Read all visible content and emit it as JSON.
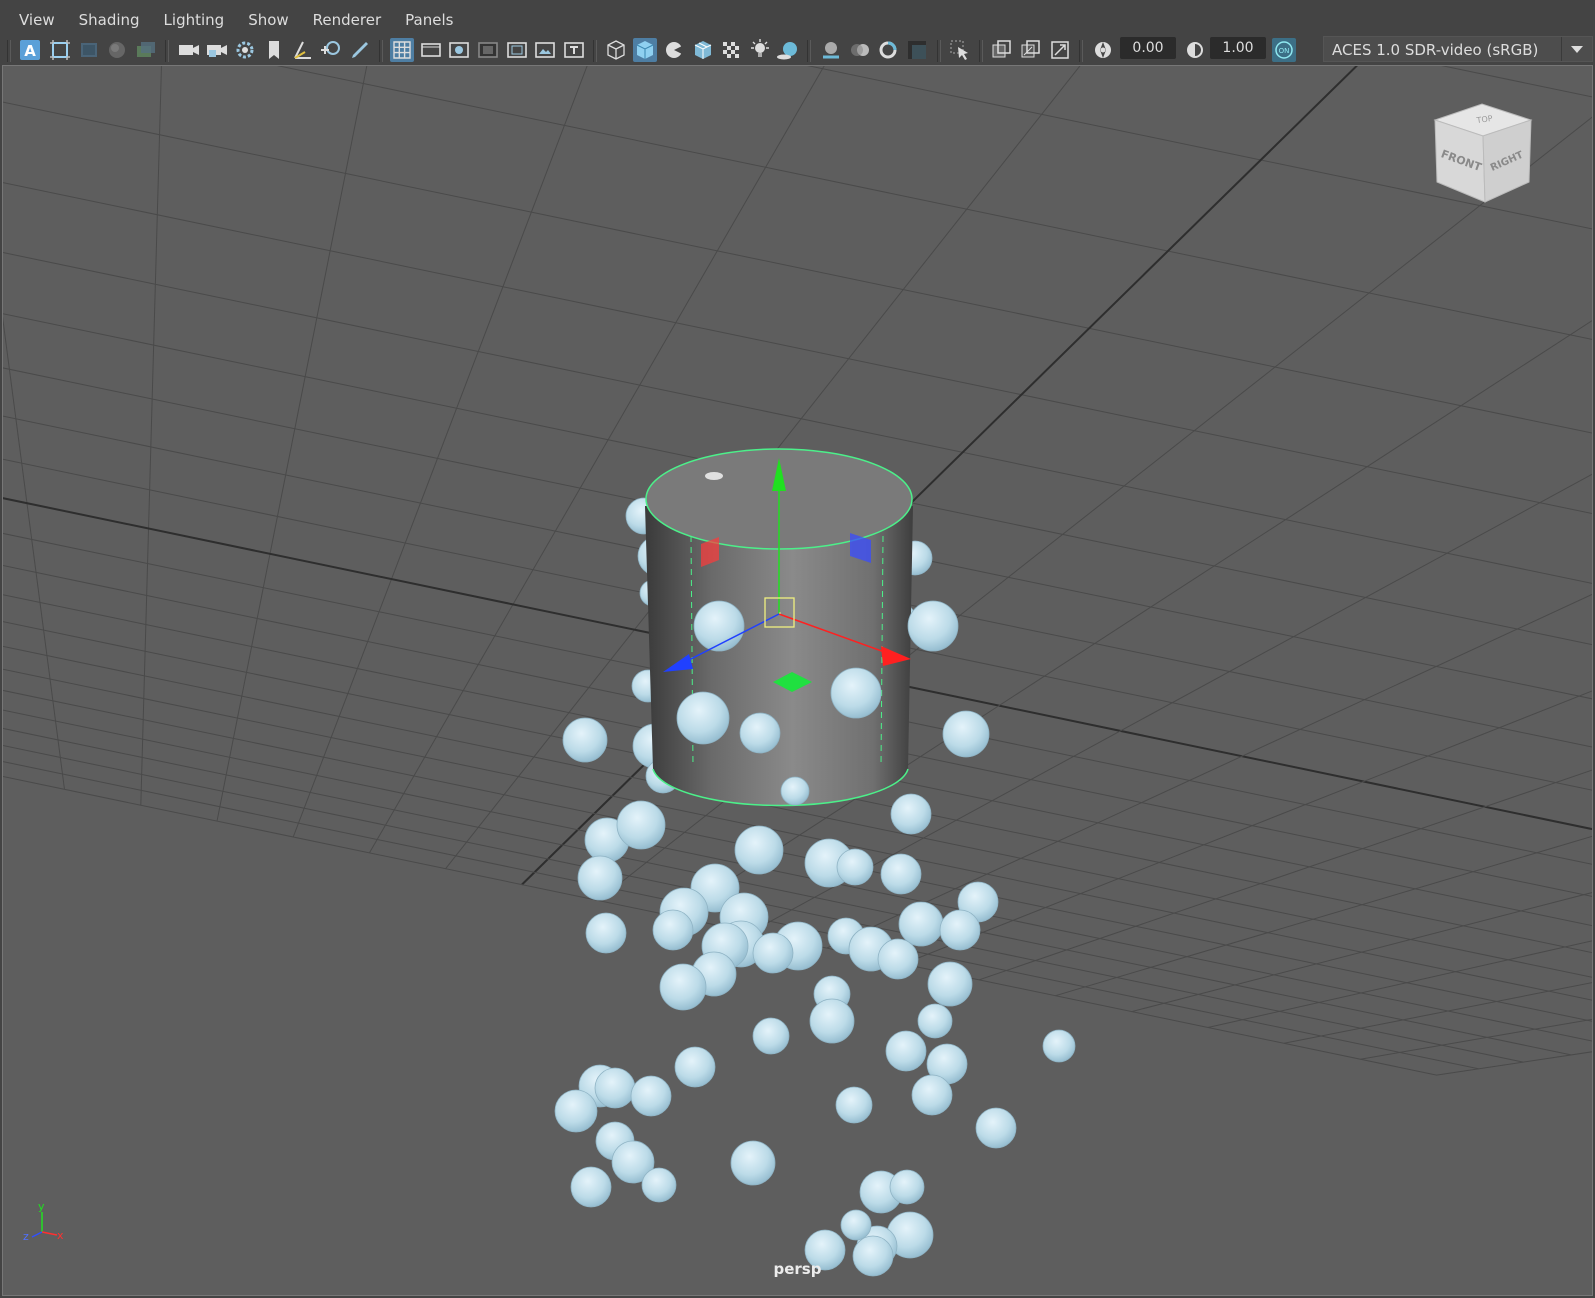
{
  "menubar": {
    "items": [
      "View",
      "Shading",
      "Lighting",
      "Show",
      "Renderer",
      "Panels"
    ]
  },
  "toolbar": {
    "exposure_value": "0.00",
    "gamma_value": "1.00",
    "color_management_toggle": "ON",
    "color_space": "ACES 1.0 SDR-video (sRGB)",
    "icons": [
      "select-camera-icon",
      "camera-attributes-icon",
      "bookmarks-icon",
      "image-plane-icon",
      "2d-pan-zoom-icon",
      "grease-pencil-icon",
      "grid-icon",
      "film-gate-icon",
      "resolution-gate-icon",
      "gate-mask-icon",
      "field-chart-icon",
      "safe-action-icon",
      "safe-title-icon",
      "wireframe-icon",
      "smooth-shade-icon",
      "use-default-material-icon",
      "wireframe-on-shaded-icon",
      "textured-icon",
      "use-all-lights-icon",
      "shadows-icon",
      "screen-space-ao-icon",
      "motion-blur-icon",
      "anti-aliasing-icon",
      "depth-of-field-icon",
      "isolate-select-icon",
      "xray-icon",
      "xray-joints-icon",
      "xray-active-components-icon",
      "exposure-icon",
      "gamma-icon",
      "view-transform-icon"
    ]
  },
  "viewport": {
    "camera_label": "persp",
    "view_cube": {
      "top": "TOP",
      "front": "FRONT",
      "right": "RIGHT"
    },
    "axis_indicator": {
      "x": "x",
      "y": "y",
      "z": "z"
    }
  },
  "colors": {
    "viewport_bg": "#5e5e5e",
    "grid_line": "#4a4a4a",
    "grid_axis": "#2e2e2e",
    "particle": "#bcdbe8",
    "selection_outline": "#4cf08a",
    "manipulator_x": "#ff2020",
    "manipulator_y": "#20e020",
    "manipulator_z": "#2040ff",
    "accent": "#4e7ea3"
  }
}
